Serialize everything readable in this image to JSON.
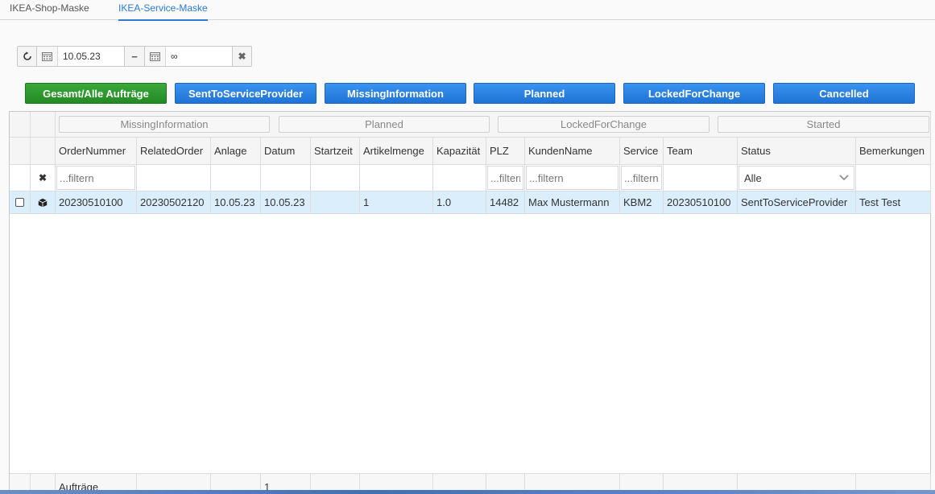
{
  "tabs": [
    "IKEA-Shop-Maske",
    "IKEA-Service-Maske"
  ],
  "daterange": {
    "from": "10.05.23",
    "to": "∞"
  },
  "status_buttons": [
    "Gesamt/Alle Aufträge",
    "SentToServiceProvider",
    "MissingInformation",
    "Planned",
    "LockedForChange",
    "Cancelled"
  ],
  "group_boxes": [
    "MissingInformation",
    "Planned",
    "LockedForChange",
    "Started"
  ],
  "columns": [
    "OrderNummer",
    "RelatedOrder",
    "Anlage",
    "Datum",
    "Startzeit",
    "Artikelmenge",
    "Kapazität",
    "PLZ",
    "KundenName",
    "Service",
    "Team",
    "Status",
    "Bemerkungen"
  ],
  "filters": {
    "ordernummer": "...filtern",
    "plz": "...filtern",
    "kundenname": "...filtern",
    "service": "...filtern",
    "status": "Alle"
  },
  "row": {
    "ordernummer": "20230510100",
    "relatedorder": "20230502120",
    "anlage": "10.05.23",
    "datum": "10.05.23",
    "startzeit": "",
    "artikelmenge": "1",
    "kapazitaet": "1.0",
    "plz": "14482",
    "kundenname": "Max Mustermann",
    "service": "KBM2",
    "team": "20230510100",
    "status": "SentToServiceProvider",
    "bemerkungen": "Test Test"
  },
  "footer": {
    "label": "Aufträge",
    "count": "1"
  },
  "colors": {
    "accent": "#2a7bd1",
    "blue_button": "#1f73d7",
    "green_button": "#248a24",
    "selected_row": "#dbeefc"
  }
}
